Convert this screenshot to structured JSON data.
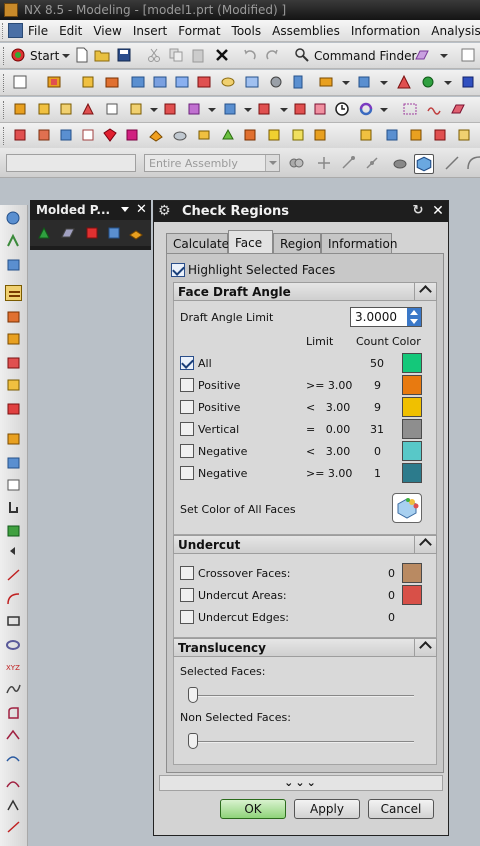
{
  "window": {
    "title": "NX 8.5 - Modeling - [model1.prt (Modified) ]"
  },
  "menubar": {
    "items": [
      "File",
      "Edit",
      "View",
      "Insert",
      "Format",
      "Tools",
      "Assemblies",
      "Information",
      "Analysis"
    ]
  },
  "toolbar": {
    "start_label": "Start",
    "command_finder_label": "Command Finder"
  },
  "selection_bar": {
    "filter_value": "",
    "scope_value": "Entire Assembly"
  },
  "navigator": {
    "title": "Molded P..."
  },
  "dialog": {
    "title": "Check Regions",
    "tabs": [
      "Calculate",
      "Face",
      "Region",
      "Information"
    ],
    "active_tab": "Face",
    "highlight_selected_faces": {
      "label": "Highlight Selected Faces",
      "checked": true
    },
    "face_draft_angle": {
      "header": "Face Draft Angle",
      "draft_angle_limit_label": "Draft Angle Limit",
      "draft_angle_limit_value": "3.0000",
      "col_limit": "Limit",
      "col_count": "Count",
      "col_color": "Color",
      "rows": [
        {
          "label": "All",
          "limit": "",
          "count": "50",
          "color": "#14c87a",
          "checked": true
        },
        {
          "label": "Positive",
          "limit": ">= 3.00",
          "count": "9",
          "color": "#e87a10",
          "checked": false
        },
        {
          "label": "Positive",
          "limit": "<   3.00",
          "count": "9",
          "color": "#f0c000",
          "checked": false
        },
        {
          "label": "Vertical",
          "limit": "=   0.00",
          "count": "31",
          "color": "#8e8e8e",
          "checked": false
        },
        {
          "label": "Negative",
          "limit": "<   3.00",
          "count": "0",
          "color": "#58c8c8",
          "checked": false
        },
        {
          "label": "Negative",
          "limit": ">= 3.00",
          "count": "1",
          "color": "#2c7b8c",
          "checked": false
        }
      ],
      "set_color_label": "Set Color of All Faces"
    },
    "undercut": {
      "header": "Undercut",
      "rows": [
        {
          "label": "Crossover Faces:",
          "count": "0",
          "color": "#b98a62",
          "checked": false
        },
        {
          "label": "Undercut Areas:",
          "count": "0",
          "color": "#d85048",
          "checked": false
        },
        {
          "label": "Undercut Edges:",
          "count": "0",
          "color": "",
          "checked": false
        }
      ]
    },
    "translucency": {
      "header": "Translucency",
      "selected_faces_label": "Selected Faces:",
      "selected_faces_value": 0,
      "non_selected_faces_label": "Non Selected Faces:",
      "non_selected_faces_value": 0
    },
    "buttons": {
      "ok": "OK",
      "apply": "Apply",
      "cancel": "Cancel"
    }
  }
}
